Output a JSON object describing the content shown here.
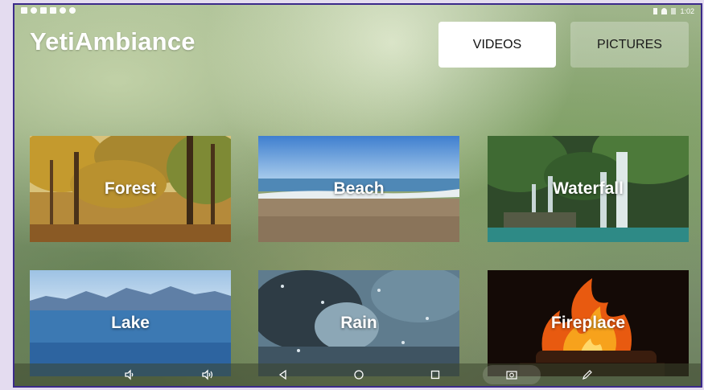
{
  "app": {
    "title": "YetiAmbiance"
  },
  "status": {
    "time": "1:02"
  },
  "tabs": [
    {
      "label": "VIDEOS",
      "selected": true
    },
    {
      "label": "PICTURES",
      "selected": false
    }
  ],
  "scenes": [
    {
      "label": "Forest"
    },
    {
      "label": "Beach"
    },
    {
      "label": "Waterfall"
    },
    {
      "label": "Lake"
    },
    {
      "label": "Rain"
    },
    {
      "label": "Fireplace"
    }
  ],
  "navbar": {
    "icons": [
      "volume-down-icon",
      "volume-up-icon",
      "back-icon",
      "home-icon",
      "recents-icon",
      "camera-icon",
      "pencil-icon"
    ]
  },
  "colors": {
    "frame": "#3b2a8a",
    "tab_selected_bg": "#ffffff"
  }
}
